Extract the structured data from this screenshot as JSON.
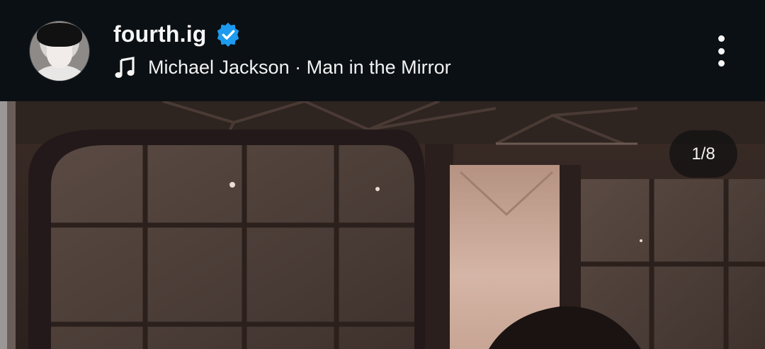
{
  "post": {
    "username": "fourth.ig",
    "verified": true,
    "audio": "Michael Jackson · Man in the Mirror",
    "counter": "1/8"
  },
  "icons": {
    "verified": "verified-badge-icon",
    "music": "music-note-icon",
    "more": "more-vertical-icon"
  },
  "colors": {
    "header_bg": "#0b1014",
    "verified_blue": "#1d9bf0"
  }
}
